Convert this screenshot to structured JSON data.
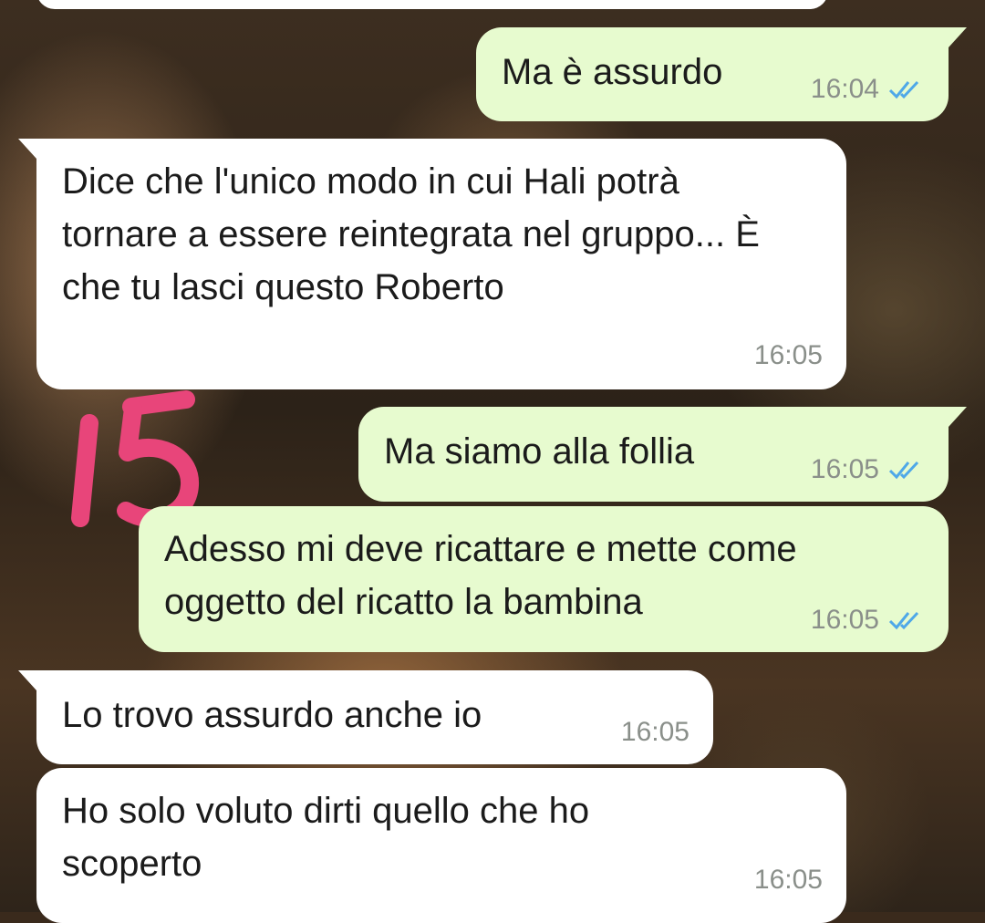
{
  "chat": {
    "messages": [
      {
        "id": "m1",
        "direction": "out",
        "text": "Ma è assurdo",
        "time": "16:04",
        "status": "read",
        "tail": true
      },
      {
        "id": "m2",
        "direction": "in",
        "text": "Dice che l'unico modo in cui Hali potrà tornare a essere reintegrata nel gruppo... È che tu lasci questo Roberto",
        "time": "16:05",
        "tail": true
      },
      {
        "id": "m3",
        "direction": "out",
        "text": "Ma siamo alla follia",
        "time": "16:05",
        "status": "read",
        "tail": true
      },
      {
        "id": "m4",
        "direction": "out",
        "text": "Adesso mi deve ricattare e mette come oggetto del ricatto la bambina",
        "time": "16:05",
        "status": "read",
        "tail": false
      },
      {
        "id": "m5",
        "direction": "in",
        "text": "Lo trovo assurdo anche io",
        "time": "16:05",
        "tail": true
      },
      {
        "id": "m6",
        "direction": "in",
        "text": "Ho solo voluto dirti quello che ho scoperto",
        "time": "16:05",
        "tail": false
      }
    ]
  },
  "annotation": {
    "text": "15",
    "color": "#e8457a"
  },
  "colors": {
    "incoming_bubble": "#ffffff",
    "outgoing_bubble": "#e7fbcf",
    "read_ticks": "#4fa8e8",
    "timestamp": "#8a8f8a"
  }
}
